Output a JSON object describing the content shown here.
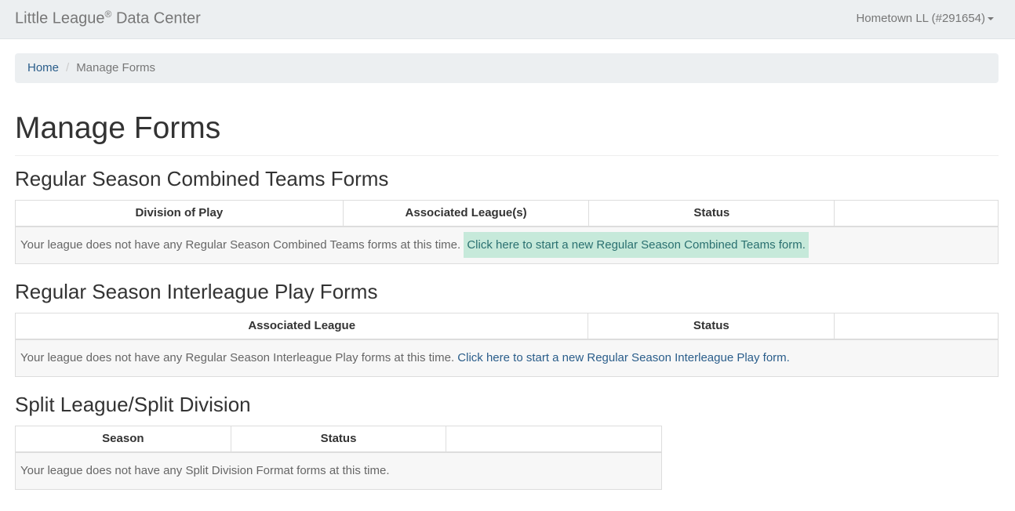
{
  "header": {
    "brand_prefix": "Little League",
    "brand_mark": "®",
    "brand_suffix": " Data Center",
    "account_label": "Hometown LL (#291654)"
  },
  "breadcrumb": {
    "home": "Home",
    "separator": "/",
    "current": "Manage Forms"
  },
  "page": {
    "title": "Manage Forms"
  },
  "sections": {
    "combined": {
      "title": "Regular Season Combined Teams Forms",
      "columns": [
        "Division of Play",
        "Associated League(s)",
        "Status",
        ""
      ],
      "empty_text": "Your league does not have any Regular Season Combined Teams forms at this time.",
      "link_text": "Click here to start a new Regular Season Combined Teams form."
    },
    "interleague": {
      "title": "Regular Season Interleague Play Forms",
      "columns": [
        "Associated League",
        "Status",
        ""
      ],
      "empty_text": "Your league does not have any Regular Season Interleague Play forms at this time.",
      "link_text": "Click here to start a new Regular Season Interleague Play form."
    },
    "split": {
      "title": "Split League/Split Division",
      "columns": [
        "Season",
        "Status",
        ""
      ],
      "empty_text": "Your league does not have any Split Division Format forms at this time."
    }
  }
}
